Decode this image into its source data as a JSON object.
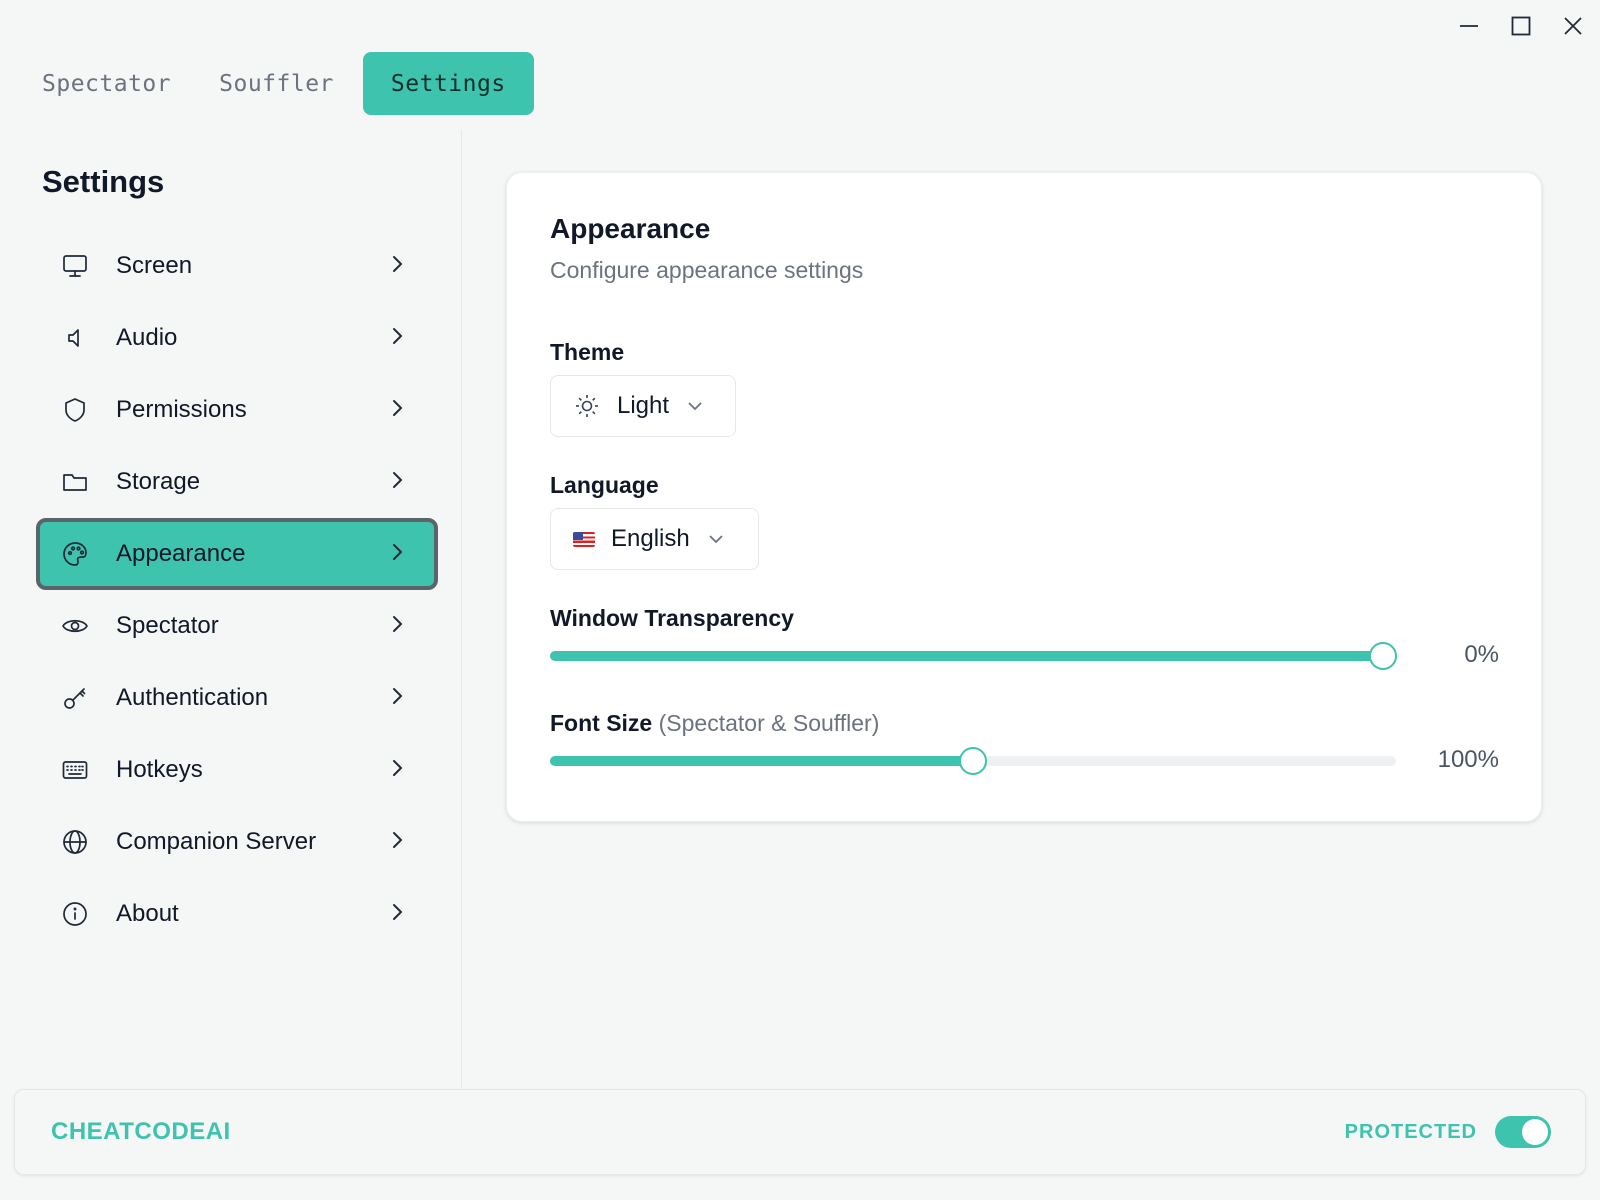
{
  "tabs": [
    {
      "label": "Spectator",
      "active": false
    },
    {
      "label": "Souffler",
      "active": false
    },
    {
      "label": "Settings",
      "active": true
    }
  ],
  "sidebar": {
    "title": "Settings",
    "items": [
      {
        "label": "Screen",
        "icon": "monitor-icon"
      },
      {
        "label": "Audio",
        "icon": "speaker-icon"
      },
      {
        "label": "Permissions",
        "icon": "shield-icon"
      },
      {
        "label": "Storage",
        "icon": "folder-icon"
      },
      {
        "label": "Appearance",
        "icon": "palette-icon",
        "active": true
      },
      {
        "label": "Spectator",
        "icon": "eye-icon"
      },
      {
        "label": "Authentication",
        "icon": "key-icon"
      },
      {
        "label": "Hotkeys",
        "icon": "keyboard-icon"
      },
      {
        "label": "Companion Server",
        "icon": "globe-icon"
      },
      {
        "label": "About",
        "icon": "info-icon"
      }
    ]
  },
  "panel": {
    "title": "Appearance",
    "subtitle": "Configure appearance settings",
    "theme": {
      "label": "Theme",
      "value": "Light",
      "icon": "sun-icon"
    },
    "language": {
      "label": "Language",
      "value": "English",
      "icon": "us-flag-icon"
    },
    "transparency": {
      "label": "Window Transparency",
      "value_text": "0%",
      "fill_fraction": 0.985
    },
    "font_size": {
      "label": "Font Size",
      "label_suffix": "(Spectator & Souffler)",
      "value_text": "100%",
      "fill_fraction": 0.5
    }
  },
  "footer": {
    "brand": "CHEATCODEAI",
    "protected_label": "PROTECTED",
    "protected_on": true
  },
  "colors": {
    "accent": "#3ec3ae",
    "background": "#f5f6f6"
  }
}
